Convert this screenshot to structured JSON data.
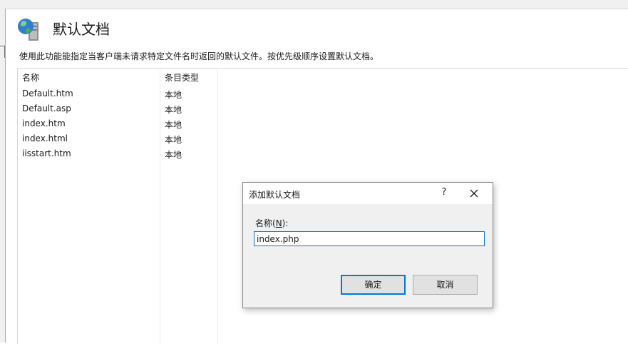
{
  "page": {
    "title": "默认文档",
    "description": "使用此功能能指定当客户端未请求特定文件名时返回的默认文件。按优先级顺序设置默认文档。"
  },
  "list": {
    "columns": [
      "名称",
      "条目类型"
    ],
    "rows": [
      {
        "name": "Default.htm",
        "type": "本地"
      },
      {
        "name": "Default.asp",
        "type": "本地"
      },
      {
        "name": "index.htm",
        "type": "本地"
      },
      {
        "name": "index.html",
        "type": "本地"
      },
      {
        "name": "iisstart.htm",
        "type": "本地"
      }
    ]
  },
  "dialog": {
    "title": "添加默认文档",
    "help": "?",
    "label_prefix": "名称(",
    "label_mnemonic": "N",
    "label_suffix": "):",
    "input_value": "index.php",
    "ok_label": "确定",
    "cancel_label": "取消"
  },
  "icons": {
    "header": "globe-server-icon",
    "close": "close-icon"
  },
  "colors": {
    "focus_accent": "#0078d7"
  }
}
